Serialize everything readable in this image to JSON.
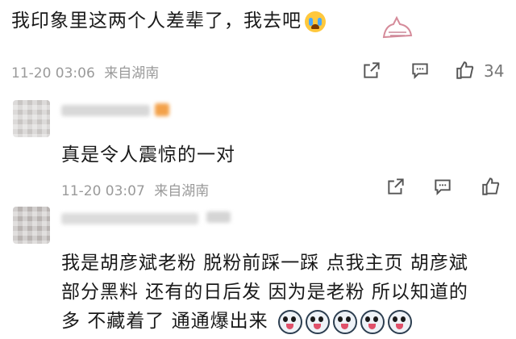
{
  "comment1": {
    "text": "我印象里这两个人差辈了，我去吧",
    "emoji": "cry-emoji",
    "time": "11-20 03:06",
    "location": "来自湖南",
    "like_count": "34"
  },
  "comment2": {
    "text": "真是令人震惊的一对",
    "time": "11-20 03:07",
    "location": "来自湖南"
  },
  "comment3": {
    "line1": "我是胡彦斌老粉 脱粉前踩一踩 点我主页 胡彦斌",
    "line2": "部分黑料 还有的日后发 因为是老粉 所以知道的",
    "line3": "多 不藏着了 通通爆出来",
    "emoji": "surprised-ghost-emoji"
  },
  "colors": {
    "meta_gray": "#9a9a9a",
    "name_orange": "#f3a14a"
  }
}
